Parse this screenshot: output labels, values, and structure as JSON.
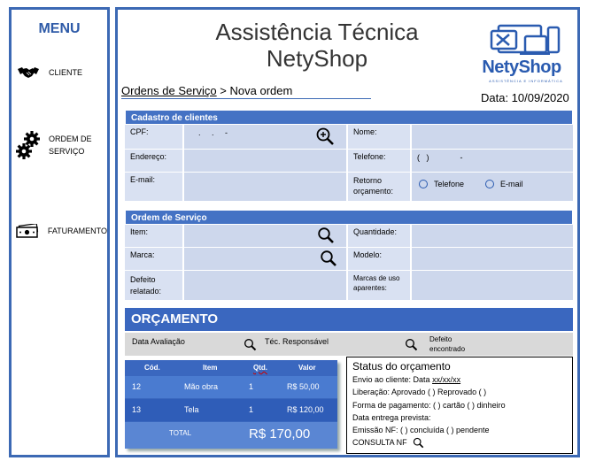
{
  "sidebar": {
    "title": "MENU",
    "items": [
      {
        "icon": "handshake-icon",
        "label": "CLIENTE"
      },
      {
        "icon": "gears-icon",
        "label_l1": "ORDEM DE",
        "label_l2": "SERVIÇO"
      },
      {
        "icon": "money-icon",
        "label": "FATURAMENTO"
      }
    ]
  },
  "header": {
    "title_l1": "Assistência Técnica",
    "title_l2": "NetyShop",
    "logo_text": "NetyShop",
    "logo_sub": "ASSISTÊNCIA E INFORMÁTICA",
    "breadcrumb_link": "Ordens de Serviço",
    "breadcrumb_sep": " > ",
    "breadcrumb_current": "Nova ordem",
    "date": "Data: 10/09/2020"
  },
  "clientes": {
    "title": "Cadastro de clientes",
    "cpf_label": "CPF:",
    "cpf_mask": ".     .     -",
    "nome_label": "Nome:",
    "endereco_label": "Endereço:",
    "telefone_label": "Telefone:",
    "telefone_mask": "(   )              -",
    "email_label": "E-mail:",
    "retorno_l1": "Retorno",
    "retorno_l2": "orçamento:",
    "opt_telefone": "Telefone",
    "opt_email": "E-mail"
  },
  "ordem": {
    "title": "Ordem de Serviço",
    "item_label": "Item:",
    "quantidade_label": "Quantidade:",
    "marca_label": "Marca:",
    "modelo_label": "Modelo:",
    "defeito_l1": "Defeito",
    "defeito_l2": "relatado:",
    "marcas_l1": "Marcas de uso",
    "marcas_l2": "aparentes:"
  },
  "orcamento": {
    "title": "ORÇAMENTO",
    "data_avaliacao": "Data Avaliação",
    "tec_responsavel": "Téc. Responsável",
    "defeito_l1": "Defeito",
    "defeito_l2": "encontrado"
  },
  "table": {
    "headers": [
      "Cód.",
      "Item",
      "Qtd.",
      "Valor"
    ],
    "rows": [
      [
        "12",
        "Mão obra",
        "1",
        "R$ 50,00"
      ],
      [
        "13",
        "Tela",
        "1",
        "R$ 120,00"
      ]
    ],
    "total_label": "TOTAL",
    "total_value": "R$ 170,00"
  },
  "status": {
    "title": "Status do orçamento",
    "envio_prefix": "Envio ao cliente: Data ",
    "envio_date": "xx/xx/xx",
    "liberacao": "Liberação:  Aprovado (  ) Reprovado (  )",
    "pagamento": "Forma de pagamento: (  ) cartão (  ) dinheiro",
    "entrega": "Data entrega prevista:",
    "emissao": "Emissão NF: (  ) concluída  (  ) pendente",
    "consulta": "CONSULTA NF"
  }
}
